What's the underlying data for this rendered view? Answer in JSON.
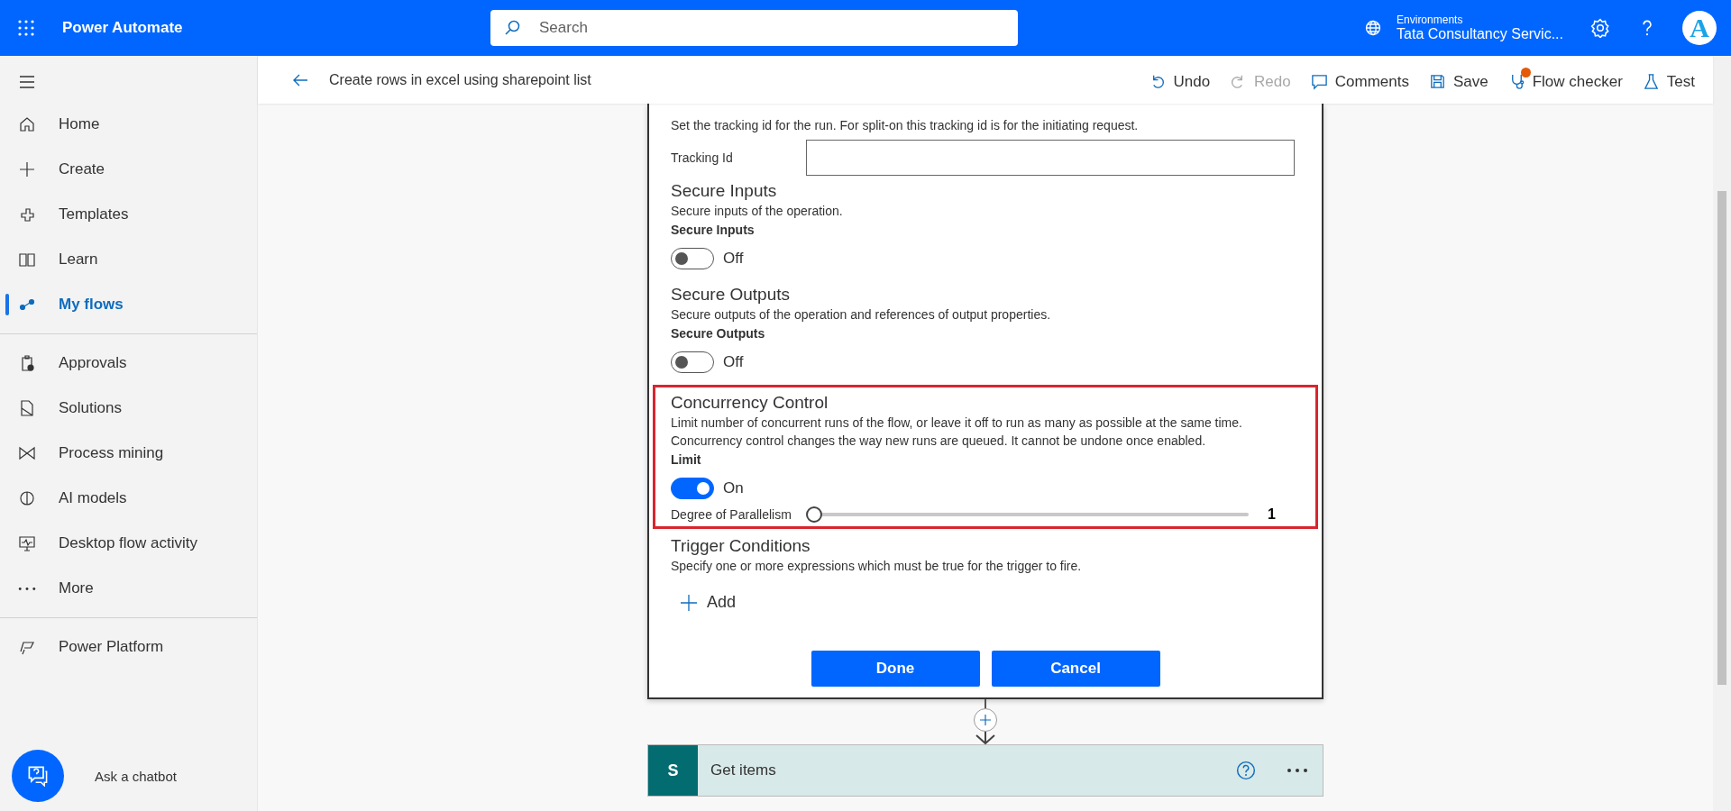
{
  "app": {
    "title": "Power Automate"
  },
  "search": {
    "placeholder": "Search"
  },
  "environment": {
    "label": "Environments",
    "name": "Tata Consultancy Servic..."
  },
  "avatar": {
    "initial": "A"
  },
  "command_bar": {
    "title": "Create rows in excel using sharepoint list",
    "commands": [
      {
        "label": "Undo",
        "disabled": false,
        "notification": false
      },
      {
        "label": "Redo",
        "disabled": true,
        "notification": false
      },
      {
        "label": "Comments",
        "disabled": false,
        "notification": false
      },
      {
        "label": "Save",
        "disabled": false,
        "notification": false
      },
      {
        "label": "Flow checker",
        "disabled": false,
        "notification": true
      },
      {
        "label": "Test",
        "disabled": false,
        "notification": false
      }
    ]
  },
  "sidebar": {
    "groups": [
      [
        {
          "label": "Home",
          "selected": false
        },
        {
          "label": "Create",
          "selected": false
        },
        {
          "label": "Templates",
          "selected": false
        },
        {
          "label": "Learn",
          "selected": false
        },
        {
          "label": "My flows",
          "selected": true
        }
      ],
      [
        {
          "label": "Approvals",
          "selected": false
        },
        {
          "label": "Solutions",
          "selected": false
        },
        {
          "label": "Process mining",
          "selected": false
        },
        {
          "label": "AI models",
          "selected": false
        },
        {
          "label": "Desktop flow activity",
          "selected": false
        },
        {
          "label": "More",
          "selected": false
        }
      ],
      [
        {
          "label": "Power Platform",
          "selected": false
        }
      ]
    ],
    "chatbot": "Ask a chatbot"
  },
  "settings": {
    "tracking": {
      "description": "Set the tracking id for the run. For split-on this tracking id is for the initiating request.",
      "field_label": "Tracking Id"
    },
    "sections": [
      {
        "title": "Secure Inputs",
        "description": "Secure inputs of the operation.",
        "toggle_label": "Secure Inputs",
        "on": false,
        "state_text": "Off",
        "highlighted": false
      },
      {
        "title": "Secure Outputs",
        "description": "Secure outputs of the operation and references of output properties.",
        "toggle_label": "Secure Outputs",
        "on": false,
        "state_text": "Off",
        "highlighted": false
      },
      {
        "title": "Concurrency Control",
        "description": "Limit number of concurrent runs of the flow, or leave it off to run as many as possible at the same time. Concurrency control changes the way new runs are queued. It cannot be undone once enabled.",
        "toggle_label": "Limit",
        "on": true,
        "state_text": "On",
        "highlighted": true,
        "slider": {
          "label": "Degree of Parallelism",
          "level": 0,
          "reading": "1"
        }
      }
    ],
    "trigger": {
      "title": "Trigger Conditions",
      "description": "Specify one or more expressions which must be true for the trigger to fire.",
      "add": "Add"
    },
    "buttons": [
      "Done",
      "Cancel"
    ]
  },
  "next_step": {
    "title": "Get items",
    "connector": "S"
  }
}
